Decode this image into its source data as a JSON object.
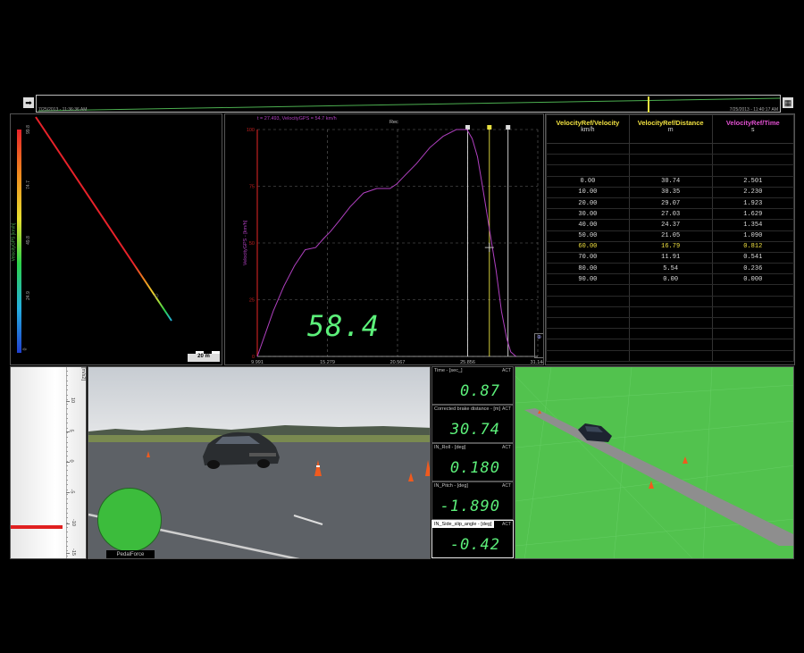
{
  "timeline": {
    "start_label": "7/25/2013 - 11:36:36 AM",
    "end_label": "7/25/2013 - 11:40:17 AM",
    "left_icon": "arrow-right-icon",
    "right_icon": "calendar-icon"
  },
  "track_map": {
    "scale_label": "20 m",
    "colorbar_title": "VelocityGPS [km/h]",
    "colorbar_ticks": [
      "99.8",
      "74.7",
      "49.8",
      "24.9",
      "0"
    ],
    "colorbar_colors": [
      "#e8222a",
      "#f08a1e",
      "#e8e030",
      "#2bd24a",
      "#25b0e0",
      "#2040d0"
    ]
  },
  "velocity_chart": {
    "header": "t = 27.493, VelocityGPS = 54.7 km/h",
    "rec_label": "Rec",
    "digital_value": "58.4",
    "line_color": "#b040c0",
    "axis_color": "#c02020",
    "accent_color": "#e8e040"
  },
  "chart_data": {
    "type": "line",
    "title": "",
    "xlabel": "",
    "ylabel": "VelocityGPS - [km/h]",
    "xlim": [
      9.991,
      31.144
    ],
    "ylim": [
      0,
      100
    ],
    "x_ticks": [
      "9.991",
      "15.279",
      "20.567",
      "25.856",
      "31.144"
    ],
    "y_ticks": [
      "0",
      "25",
      "50",
      "75",
      "100"
    ],
    "series": [
      {
        "name": "VelocityGPS",
        "x": [
          9.99,
          10.6,
          11.2,
          12.0,
          12.8,
          13.6,
          14.4,
          15.0,
          15.5,
          16.2,
          17.0,
          18.0,
          19.0,
          20.0,
          20.5,
          21.0,
          22.0,
          23.0,
          24.0,
          25.0,
          25.8,
          26.2,
          26.6,
          27.0,
          27.5,
          28.0,
          28.4,
          28.8,
          29.1,
          29.5
        ],
        "y": [
          0,
          10,
          20,
          31,
          40,
          47,
          48,
          52,
          55,
          60,
          66,
          72,
          74,
          74,
          76,
          79,
          85,
          92,
          97,
          100,
          100,
          96,
          88,
          74,
          56,
          38,
          20,
          8,
          2,
          0
        ]
      }
    ],
    "cursors": [
      25.856,
      27.493,
      28.9
    ],
    "grid": true
  },
  "table": {
    "columns": [
      {
        "title": "VelocityRef/Velocity",
        "unit": "km/h",
        "color": "#f0e040"
      },
      {
        "title": "VelocityRef/Distance",
        "unit": "m",
        "color": "#f0e040"
      },
      {
        "title": "VelocityRef/Time",
        "unit": "s",
        "color": "#e050d0"
      }
    ],
    "rows": [
      [
        "",
        "",
        ""
      ],
      [
        "",
        "",
        ""
      ],
      [
        "",
        "",
        ""
      ],
      [
        "0.00",
        "30.74",
        "2.501"
      ],
      [
        "10.00",
        "30.35",
        "2.230"
      ],
      [
        "20.00",
        "29.07",
        "1.923"
      ],
      [
        "30.00",
        "27.03",
        "1.629"
      ],
      [
        "40.00",
        "24.37",
        "1.354"
      ],
      [
        "50.00",
        "21.05",
        "1.090"
      ],
      [
        "60.00",
        "16.79",
        "0.812"
      ],
      [
        "70.00",
        "11.91",
        "0.541"
      ],
      [
        "80.00",
        "5.54",
        "0.236"
      ],
      [
        "90.00",
        "0.00",
        "0.000"
      ],
      [
        "",
        "",
        ""
      ],
      [
        "",
        "",
        ""
      ],
      [
        "",
        "",
        ""
      ],
      [
        "",
        "",
        ""
      ],
      [
        "",
        "",
        ""
      ],
      [
        "",
        "",
        ""
      ],
      [
        "",
        "",
        ""
      ]
    ],
    "highlight_row": 9
  },
  "bar_gauge": {
    "unit": "[m/s2]",
    "ticks": [
      "10",
      "5",
      "0",
      "-5",
      "-10",
      "-15"
    ],
    "level_color": "#e02020"
  },
  "video": {
    "pedal_label": "PedalForce",
    "pedal_color": "#3cbc3c"
  },
  "readouts": [
    {
      "label": "Time - [sec_]",
      "value": "0.87",
      "act": "ACT",
      "selected": false
    },
    {
      "label": "Corrected brake distance - [m]",
      "value": "30.74",
      "act": "ACT",
      "selected": false
    },
    {
      "label": "IN_Roll - [deg]",
      "value": "0.180",
      "act": "ACT",
      "selected": false
    },
    {
      "label": "IN_Pitch - [deg]",
      "value": "-1.890",
      "act": "ACT",
      "selected": false
    },
    {
      "label": "IN_Side_slip_angle - [deg]",
      "value": "-0.42",
      "act": "ACT",
      "selected": true
    }
  ],
  "scene3d": {
    "ground_color": "#52c24e",
    "track_color": "#8e8e8e",
    "car_color": "#1d2430"
  }
}
